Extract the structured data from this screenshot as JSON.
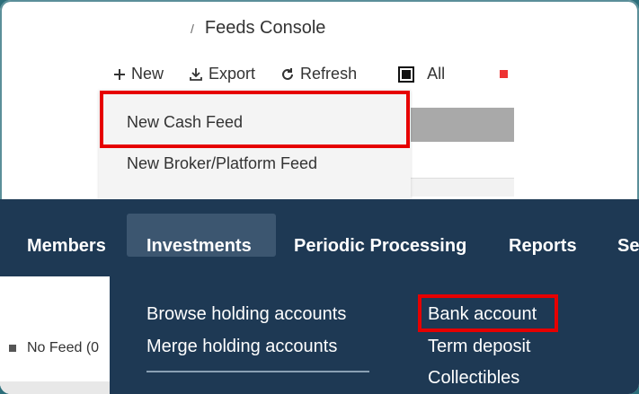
{
  "breadcrumb": {
    "separator": "/",
    "current": "Feeds Console"
  },
  "toolbar": {
    "new_label": "New",
    "export_label": "Export",
    "refresh_label": "Refresh",
    "all_label": "All",
    "new_icon": "plus-icon",
    "export_icon": "download-icon",
    "refresh_icon": "refresh-icon"
  },
  "dropdown": {
    "items": [
      {
        "label": "New Cash Feed"
      },
      {
        "label": "New Broker/Platform Feed"
      }
    ]
  },
  "nav": {
    "items": [
      {
        "label": "Members"
      },
      {
        "label": "Investments"
      },
      {
        "label": "Periodic Processing"
      },
      {
        "label": "Reports"
      },
      {
        "label": "Se"
      }
    ],
    "active": "Investments"
  },
  "investments_menu": {
    "left_links": [
      {
        "label": "Browse holding accounts"
      },
      {
        "label": "Merge holding accounts"
      }
    ],
    "right_links": [
      {
        "label": "Bank account"
      },
      {
        "label": "Term deposit"
      },
      {
        "label": "Collectibles"
      }
    ]
  },
  "feed_list": {
    "item_label": "No Feed (0"
  },
  "colors": {
    "navbar": "#1e3954",
    "active_nav": "#3c5670",
    "highlight": "#e60000"
  }
}
